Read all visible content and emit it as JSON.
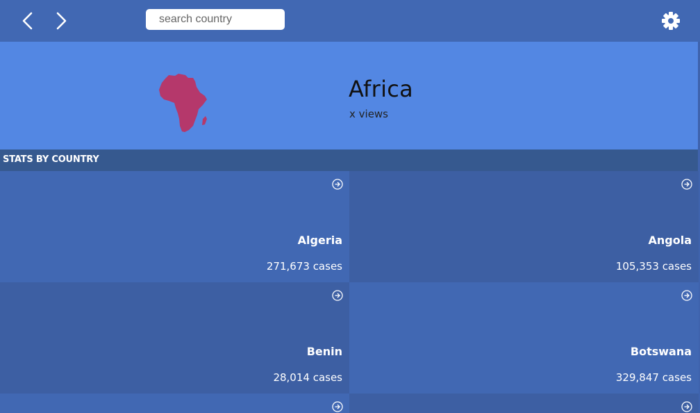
{
  "topbar": {
    "back_icon": "chevron-left-icon",
    "forward_icon": "chevron-right-icon",
    "search_placeholder": "search country",
    "settings_icon": "gear-icon"
  },
  "hero": {
    "title": "Africa",
    "views": "x views",
    "map_icon": "africa-continent-map",
    "map_color": "#b5386b"
  },
  "section": {
    "title": "STATS BY COUNTRY"
  },
  "countries": [
    {
      "name": "Algeria",
      "cases": "271,673 cases"
    },
    {
      "name": "Angola",
      "cases": "105,353 cases"
    },
    {
      "name": "Benin",
      "cases": "28,014 cases"
    },
    {
      "name": "Botswana",
      "cases": "329,847 cases"
    },
    {
      "name": "",
      "cases": ""
    },
    {
      "name": "",
      "cases": ""
    }
  ],
  "colors": {
    "topbar": "#4168b3",
    "hero": "#5387e3",
    "section_header": "#36598f",
    "tile_light": "#4168b3",
    "tile_dark": "#3d5fa3"
  }
}
